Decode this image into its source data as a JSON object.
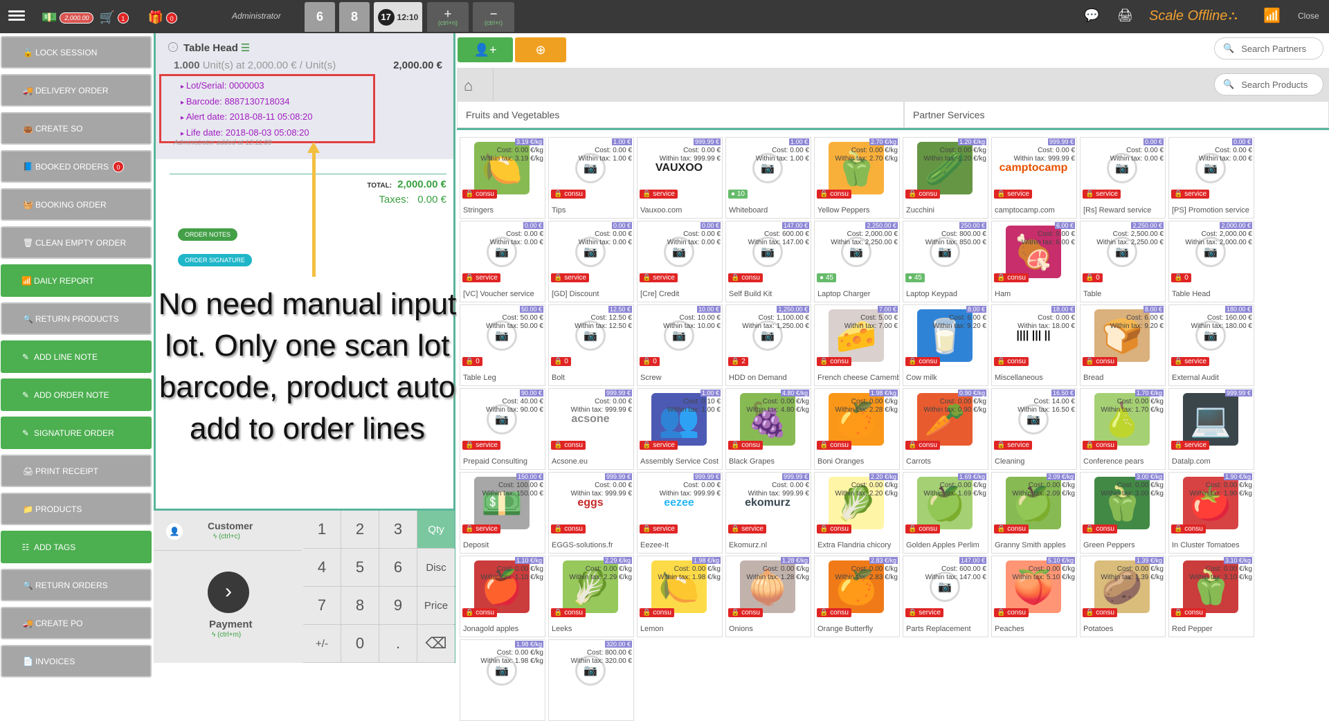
{
  "topbar": {
    "cash_amount": "2,000.00",
    "cart_count": "1",
    "gift_count": "0",
    "user": "Administrator",
    "order_tabs": [
      "6",
      "8",
      "17"
    ],
    "active_time": "12:10",
    "add_shortcut": "(ctrl+n)",
    "remove_shortcut": "(ctrl+r)",
    "scale_status": "Scale Offline",
    "close_label": "Close"
  },
  "left_buttons": [
    {
      "label": "Lock Session",
      "style": "gray",
      "icon": "lock-icon"
    },
    {
      "label": "Delivery Order",
      "style": "gray",
      "icon": "truck-icon"
    },
    {
      "label": "Create SO",
      "style": "gray",
      "icon": "bag-icon"
    },
    {
      "label": "Booked Orders",
      "style": "gray",
      "icon": "book-icon",
      "count": "0"
    },
    {
      "label": "Booking Order",
      "style": "gray",
      "icon": "basket-icon"
    },
    {
      "label": "Clean Empty Order",
      "style": "gray",
      "icon": "trash-icon"
    },
    {
      "label": "Daily Report",
      "style": "green",
      "icon": "signal-icon"
    },
    {
      "label": "Return Products",
      "style": "gray",
      "icon": "search-icon"
    },
    {
      "label": "Add Line Note",
      "style": "green",
      "icon": "edit-icon"
    },
    {
      "label": "Add Order Note",
      "style": "green",
      "icon": "edit-icon"
    },
    {
      "label": "Signature Order",
      "style": "green",
      "icon": "edit-icon"
    },
    {
      "label": "Print Receipt",
      "style": "gray",
      "icon": "print-icon"
    },
    {
      "label": "Products",
      "style": "gray",
      "icon": "folder-icon"
    },
    {
      "label": "Add Tags",
      "style": "green",
      "icon": "sliders-icon"
    },
    {
      "label": "Return Orders",
      "style": "gray",
      "icon": "search-icon"
    },
    {
      "label": "Create PO",
      "style": "gray",
      "icon": "truck-icon"
    },
    {
      "label": "Invoices",
      "style": "gray",
      "icon": "file-icon"
    }
  ],
  "order": {
    "product": "Table Head",
    "qty_line_a": "1.000",
    "qty_line_b": "Unit(s) at 2,000.00 € / Unit(s)",
    "price": "2,000.00 €",
    "lot": [
      "Lot/Serial: 0000003",
      "Barcode: 8887130718034",
      "Alert date: 2018-08-11 05:08:20",
      "Life date: 2018-08-03 05:08:20"
    ],
    "hidden_note": "Administrator added at 12:11:09",
    "total_label": "TOTAL:",
    "total": "2,000.00 €",
    "taxes_label": "Taxes:",
    "taxes": "0.00 €",
    "order_notes": "Order Notes",
    "order_signature": "Order Signature"
  },
  "annotation": "No need manual input lot. Only one scan lot barcode, product auto add to order lines",
  "customer": {
    "label": "Customer",
    "shortcut": "(ctrl+c)"
  },
  "payment": {
    "label": "Payment",
    "shortcut": "(ctrl+m)"
  },
  "numpad": [
    "1",
    "2",
    "3",
    "Qty",
    "4",
    "5",
    "6",
    "Disc",
    "7",
    "8",
    "9",
    "Price",
    "+/-",
    "0",
    ".",
    "⌫"
  ],
  "search": {
    "partners": "Search Partners",
    "products": "Search Products"
  },
  "categories": [
    "Fruits and Vegetables",
    "Partner Services"
  ],
  "colors": {
    "accent_green": "#4caf50",
    "orange": "#f0a030",
    "teal": "#59b59b",
    "red": "#e02424",
    "price_tag": "#8c86d6"
  },
  "products": [
    {
      "name": "Stringers",
      "tag": "3.19 €/kg",
      "cost": "Cost: 0.00 €/kg",
      "tax": "Within tax: 3.19 €/kg",
      "badge": "consu",
      "emoji": "🍋",
      "bg": "#7cb342"
    },
    {
      "name": "Tips",
      "tag": "1.00 €",
      "cost": "Cost: 0.00 €",
      "tax": "Within tax: 1.00 €",
      "badge": "consu"
    },
    {
      "name": "Vauxoo.com",
      "tag": "999.99 €",
      "cost": "Cost: 0.00 €",
      "tax": "Within tax: 999.99 €",
      "badge": "service",
      "logo": "VAUXOO",
      "logocolor": "#222"
    },
    {
      "name": "Whiteboard",
      "tag": "1.00 €",
      "cost": "Cost: 0.00 €",
      "tax": "Within tax: 1.00 €",
      "badge": "10",
      "badgeColor": "#66bb6a"
    },
    {
      "name": "Yellow Peppers",
      "tag": "2.70 €/kg",
      "cost": "Cost: 0.00 €/kg",
      "tax": "Within tax: 2.70 €/kg",
      "badge": "consu",
      "emoji": "🫑",
      "bg": "#f9a825"
    },
    {
      "name": "Zucchini",
      "tag": "1.20 €/kg",
      "cost": "Cost: 0.00 €/kg",
      "tax": "Within tax: 1.20 €/kg",
      "badge": "consu",
      "emoji": "🥒",
      "bg": "#558b2f"
    },
    {
      "name": "camptocamp.com",
      "tag": "999.99 €",
      "cost": "Cost: 0.00 €",
      "tax": "Within tax: 999.99 €",
      "badge": "service",
      "logo": "camptocamp",
      "logocolor": "#e65100"
    },
    {
      "name": "[Rs] Reward service",
      "tag": "0.00 €",
      "cost": "Cost: 0.00 €",
      "tax": "Within tax: 0.00 €",
      "badge": "service"
    },
    {
      "name": "[PS] Promotion service",
      "tag": "0.00 €",
      "cost": "Cost: 0.00 €",
      "tax": "Within tax: 0.00 €",
      "badge": "service"
    },
    {
      "name": "[VC] Voucher service",
      "tag": "0.00 €",
      "cost": "Cost: 0.00 €",
      "tax": "Within tax: 0.00 €",
      "badge": "service"
    },
    {
      "name": "[GD] Discount",
      "tag": "0.00 €",
      "cost": "Cost: 0.00 €",
      "tax": "Within tax: 0.00 €",
      "badge": "service"
    },
    {
      "name": "[Cre] Credit",
      "tag": "0.00 €",
      "cost": "Cost: 0.00 €",
      "tax": "Within tax: 0.00 €",
      "badge": "service"
    },
    {
      "name": "Self Build Kit",
      "tag": "147.00 €",
      "cost": "Cost: 600.00 €",
      "tax": "Within tax: 147.00 €",
      "badge": "consu"
    },
    {
      "name": "Laptop Charger",
      "tag": "2,250.00 €",
      "cost": "Cost: 2,000.00 €",
      "tax": "Within tax: 2,250.00 €",
      "badge": "45",
      "badgeColor": "#66bb6a"
    },
    {
      "name": "Laptop Keypad",
      "tag": "250.00 €",
      "cost": "Cost: 800.00 €",
      "tax": "Within tax: 850.00 €",
      "badge": "45",
      "badgeColor": "#66bb6a"
    },
    {
      "name": "Ham",
      "tag": "6.00 €",
      "cost": "Cost: 0.00 €",
      "tax": "Within tax: 6.00 €",
      "badge": "consu",
      "emoji": "🍖",
      "bg": "#c2185b"
    },
    {
      "name": "Table",
      "tag": "2,250.00 €",
      "cost": "Cost: 2,500.00 €",
      "tax": "Within tax: 2,250.00 €",
      "badge": "0"
    },
    {
      "name": "Table Head",
      "tag": "2,000.00 €",
      "cost": "Cost: 2,000.00 €",
      "tax": "Within tax: 2,000.00 €",
      "badge": "0"
    },
    {
      "name": "Table Leg",
      "tag": "50.00 €",
      "cost": "Cost: 50.00 €",
      "tax": "Within tax: 50.00 €",
      "badge": "0"
    },
    {
      "name": "Bolt",
      "tag": "12.50 €",
      "cost": "Cost: 12.50 €",
      "tax": "Within tax: 12.50 €",
      "badge": "0"
    },
    {
      "name": "Screw",
      "tag": "10.00 €",
      "cost": "Cost: 10.00 €",
      "tax": "Within tax: 10.00 €",
      "badge": "0"
    },
    {
      "name": "HDD on Demand",
      "tag": "1,250.00 €",
      "cost": "Cost: 1,100.00 €",
      "tax": "Within tax: 1,250.00 €",
      "badge": "2"
    },
    {
      "name": "French cheese Camembert",
      "tag": "7.00 €",
      "cost": "Cost: 5.00 €",
      "tax": "Within tax: 7.00 €",
      "badge": "consu",
      "emoji": "🧀",
      "bg": "#d7ccc8"
    },
    {
      "name": "Cow milk",
      "tag": "8.00 €",
      "cost": "Cost: 6.00 €",
      "tax": "Within tax: 9.20 €",
      "badge": "consu",
      "emoji": "🥛",
      "bg": "#1976d2"
    },
    {
      "name": "Miscellaneous",
      "tag": "18.00 €",
      "cost": "Cost: 0.00 €",
      "tax": "Within tax: 18.00 €",
      "badge": "consu",
      "logo": "|||| ||| ||",
      "logocolor": "#111"
    },
    {
      "name": "Bread",
      "tag": "8.00 €",
      "cost": "Cost: 6.00 €",
      "tax": "Within tax: 9.20 €",
      "badge": "consu",
      "emoji": "🍞",
      "bg": "#d7a86e"
    },
    {
      "name": "External Audit",
      "tag": "180.00 €",
      "cost": "Cost: 160.00 €",
      "tax": "Within tax: 180.00 €",
      "badge": "service"
    },
    {
      "name": "Prepaid Consulting",
      "tag": "90.00 €",
      "cost": "Cost: 40.00 €",
      "tax": "Within tax: 90.00 €",
      "badge": "service"
    },
    {
      "name": "Acsone.eu",
      "tag": "999.99 €",
      "cost": "Cost: 0.00 €",
      "tax": "Within tax: 999.99 €",
      "badge": "consu",
      "logo": "acsone",
      "logocolor": "#888"
    },
    {
      "name": "Assembly Service Cost",
      "tag": "1.00 €",
      "cost": "Cost: 0.10 €",
      "tax": "Within tax: 1.00 €",
      "badge": "service",
      "emoji": "👥",
      "bg": "#3949ab"
    },
    {
      "name": "Black Grapes",
      "tag": "4.80 €/kg",
      "cost": "Cost: 0.00 €/kg",
      "tax": "Within tax: 4.80 €/kg",
      "badge": "consu",
      "emoji": "🍇",
      "bg": "#7cb342"
    },
    {
      "name": "Boni Oranges",
      "tag": "1.98 €/kg",
      "cost": "Cost: 0.00 €/kg",
      "tax": "Within tax: 2.28 €/kg",
      "badge": "consu",
      "emoji": "🍊",
      "bg": "#fb8c00"
    },
    {
      "name": "Carrots",
      "tag": "0.90 €/kg",
      "cost": "Cost: 0.00 €/kg",
      "tax": "Within tax: 0.90 €/kg",
      "badge": "consu",
      "emoji": "🥕",
      "bg": "#e64a19"
    },
    {
      "name": "Cleaning",
      "tag": "16.50 €",
      "cost": "Cost: 14.00 €",
      "tax": "Within tax: 16.50 €",
      "badge": "service"
    },
    {
      "name": "Conference pears",
      "tag": "1.70 €/kg",
      "cost": "Cost: 0.00 €/kg",
      "tax": "Within tax: 1.70 €/kg",
      "badge": "consu",
      "emoji": "🍐",
      "bg": "#9ccc65"
    },
    {
      "name": "Datalp.com",
      "tag": "999.99 €",
      "cost": "",
      "tax": "",
      "badge": "service",
      "emoji": "💻",
      "bg": "#263238"
    },
    {
      "name": "Deposit",
      "tag": "150.00 €",
      "cost": "Cost: 100.00 €",
      "tax": "Within tax: 150.00 €",
      "badge": "service",
      "emoji": "💵",
      "bg": "#9e9e9e"
    },
    {
      "name": "EGGS-solutions.fr",
      "tag": "999.99 €",
      "cost": "Cost: 0.00 €",
      "tax": "Within tax: 999.99 €",
      "badge": "consu",
      "logo": "eggs",
      "logocolor": "#c62828"
    },
    {
      "name": "Eezee-It",
      "tag": "999.99 €",
      "cost": "Cost: 0.00 €",
      "tax": "Within tax: 999.99 €",
      "badge": "service",
      "logo": "eezee",
      "logocolor": "#29b6f6"
    },
    {
      "name": "Ekomurz.nl",
      "tag": "999.99 €",
      "cost": "Cost: 0.00 €",
      "tax": "Within tax: 999.99 €",
      "badge": "service",
      "logo": "ekomurz",
      "logocolor": "#37474f"
    },
    {
      "name": "Extra Flandria chicory",
      "tag": "2.20 €/kg",
      "cost": "Cost: 0.00 €/kg",
      "tax": "Within tax: 2.20 €/kg",
      "badge": "consu",
      "emoji": "🥬",
      "bg": "#fff59d"
    },
    {
      "name": "Golden Apples Perlim",
      "tag": "1.69 €/kg",
      "cost": "Cost: 0.00 €/kg",
      "tax": "Within tax: 1.69 €/kg",
      "badge": "consu",
      "emoji": "🍏",
      "bg": "#9ccc65"
    },
    {
      "name": "Granny Smith apples",
      "tag": "2.09 €/kg",
      "cost": "Cost: 0.00 €/kg",
      "tax": "Within tax: 2.09 €/kg",
      "badge": "consu",
      "emoji": "🍏",
      "bg": "#7cb342"
    },
    {
      "name": "Green Peppers",
      "tag": "3.00 €/kg",
      "cost": "Cost: 0.00 €/kg",
      "tax": "Within tax: 3.00 €/kg",
      "badge": "consu",
      "emoji": "🫑",
      "bg": "#2e7d32"
    },
    {
      "name": "In Cluster Tomatoes",
      "tag": "1.90 €/kg",
      "cost": "Cost: 0.00 €/kg",
      "tax": "Within tax: 1.90 €/kg",
      "badge": "consu",
      "emoji": "🍅",
      "bg": "#d32f2f"
    },
    {
      "name": "Jonagold apples",
      "tag": "1.10 €/kg",
      "cost": "Cost: 0.00 €/kg",
      "tax": "Within tax: 1.10 €/kg",
      "badge": "consu",
      "emoji": "🍎",
      "bg": "#c62828"
    },
    {
      "name": "Leeks",
      "tag": "2.29 €/kg",
      "cost": "Cost: 0.00 €/kg",
      "tax": "Within tax: 2.29 €/kg",
      "badge": "consu",
      "emoji": "🥬",
      "bg": "#8bc34a"
    },
    {
      "name": "Lemon",
      "tag": "1.98 €/kg",
      "cost": "Cost: 0.00 €/kg",
      "tax": "Within tax: 1.98 €/kg",
      "badge": "consu",
      "emoji": "🍋",
      "bg": "#fdd835"
    },
    {
      "name": "Onions",
      "tag": "1.28 €/kg",
      "cost": "Cost: 0.00 €/kg",
      "tax": "Within tax: 1.28 €/kg",
      "badge": "consu",
      "emoji": "🧅",
      "bg": "#bcaaa4"
    },
    {
      "name": "Orange Butterfly",
      "tag": "2.83 €/kg",
      "cost": "Cost: 0.00 €/kg",
      "tax": "Within tax: 2.83 €/kg",
      "badge": "consu",
      "emoji": "🍊",
      "bg": "#ef6c00"
    },
    {
      "name": "Parts Replacement",
      "tag": "147.00 €",
      "cost": "Cost: 600.00 €",
      "tax": "Within tax: 147.00 €",
      "badge": "service"
    },
    {
      "name": "Peaches",
      "tag": "5.10 €/kg",
      "cost": "Cost: 0.00 €/kg",
      "tax": "Within tax: 5.10 €/kg",
      "badge": "consu",
      "emoji": "🍑",
      "bg": "#ff8a65"
    },
    {
      "name": "Potatoes",
      "tag": "1.39 €/kg",
      "cost": "Cost: 0.00 €/kg",
      "tax": "Within tax: 1.39 €/kg",
      "badge": "consu",
      "emoji": "🥔",
      "bg": "#d7b56d"
    },
    {
      "name": "Red Pepper",
      "tag": "3.10 €/kg",
      "cost": "Cost: 0.00 €/kg",
      "tax": "Within tax: 3.10 €/kg",
      "badge": "consu",
      "emoji": "🫑",
      "bg": "#c62828"
    },
    {
      "name": "",
      "tag": "1.98 €/kg",
      "cost": "Cost: 0.00 €/kg",
      "tax": "Within tax: 1.98 €/kg",
      "badge": ""
    },
    {
      "name": "",
      "tag": "320.00 €",
      "cost": "Cost: 800.00 €",
      "tax": "Within tax: 320.00 €",
      "badge": ""
    }
  ]
}
